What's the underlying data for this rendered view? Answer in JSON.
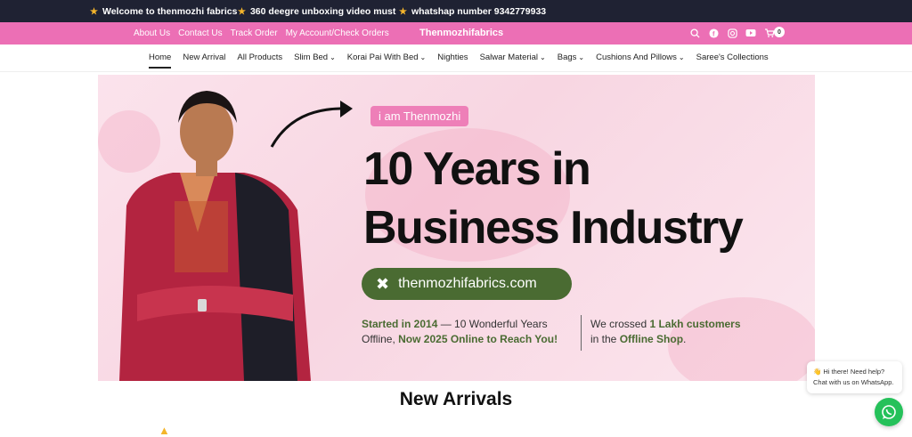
{
  "announcement": {
    "items": [
      "Welcome to thenmozhi fabrics",
      "360 deegre unboxing video must",
      "whatshap number 9342779933"
    ],
    "star_icon": "star-icon"
  },
  "utility": {
    "links": [
      "About Us",
      "Contact Us",
      "Track Order",
      "My Account/Check Orders"
    ],
    "brand": "Thenmozhifabrics",
    "cart_count": "0"
  },
  "nav": {
    "items": [
      "Home",
      "New Arrival",
      "All Products",
      "Slim Bed",
      "Korai Pai With Bed",
      "Nighties",
      "Salwar Material",
      "Bags",
      "Cushions And Pillows",
      "Saree's Collections"
    ]
  },
  "hero": {
    "tag": "i am Thenmozhi",
    "headline_line1": "10 Years in",
    "headline_line2": "Business Industry",
    "site": "thenmozhifabrics.com",
    "left_bold1": "Started in 2014",
    "left_text1": " — 10 Wonderful Years",
    "left_text2": "Offline, ",
    "left_bold2": "Now 2025 Online to Reach You!",
    "right_text1": "We crossed ",
    "right_bold1": "1 Lakh customers",
    "right_text2": "in the ",
    "right_bold2": "Offline Shop",
    "right_text3": "."
  },
  "section": {
    "title": "New Arrivals"
  },
  "chat": {
    "line1": "👋 Hi there! Need help?",
    "line2": "Chat with us on WhatsApp."
  },
  "colors": {
    "pink": "#ec6fb5",
    "dark": "#1f2233",
    "green": "#4a6b32",
    "whatsapp": "#25c15a"
  }
}
